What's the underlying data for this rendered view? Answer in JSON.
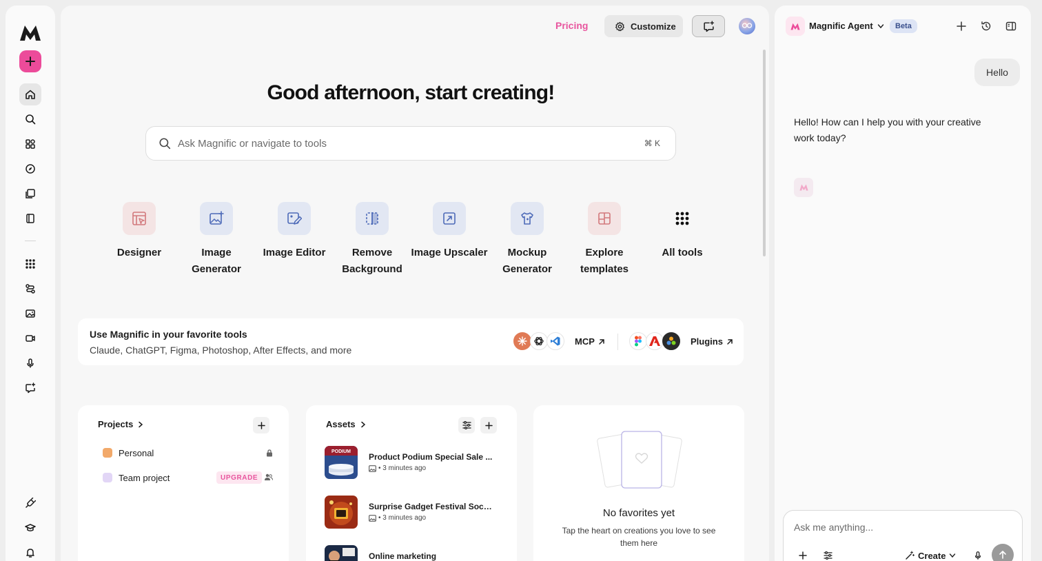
{
  "header": {
    "pricing": "Pricing",
    "customize": "Customize"
  },
  "hero": {
    "greeting": "Good afternoon, start creating!",
    "search_placeholder": "Ask Magnific or navigate to tools",
    "shortcut": "⌘ K"
  },
  "tools": [
    {
      "label": "Designer"
    },
    {
      "label": "Image Generator"
    },
    {
      "label": "Image Editor"
    },
    {
      "label": "Remove Background"
    },
    {
      "label": "Image Upscaler"
    },
    {
      "label": "Mockup Generator"
    },
    {
      "label": "Explore templates"
    },
    {
      "label": "All tools"
    }
  ],
  "integrations": {
    "title": "Use Magnific in your favorite tools",
    "subtitle": "Claude, ChatGPT, Figma, Photoshop, After Effects, and more",
    "mcp": "MCP",
    "plugins": "Plugins"
  },
  "projects": {
    "title": "Projects",
    "items": [
      {
        "name": "Personal",
        "color": "#f2a96a"
      },
      {
        "name": "Team project",
        "color": "#e2d6f6"
      }
    ],
    "upgrade": "UPGRADE"
  },
  "assets": {
    "title": "Assets",
    "items": [
      {
        "name": "Product Podium Special Sale ...",
        "meta": "• 3 minutes ago"
      },
      {
        "name": "Surprise Gadget Festival Soci...",
        "meta": "• 3 minutes ago"
      },
      {
        "name": "Online marketing",
        "meta": ""
      }
    ]
  },
  "favorites": {
    "title": "No favorites yet",
    "subtitle": "Tap the heart on creations you love to see them here"
  },
  "agent": {
    "name": "Magnific Agent",
    "badge": "Beta",
    "user_message": "Hello",
    "reply": "Hello! How can I help you with your creative work today?",
    "input_placeholder": "Ask me anything...",
    "mode": "Create"
  },
  "colors": {
    "accent": "#ec4b9a",
    "pricing": "#e8559e",
    "beta_bg": "#dde4f5"
  }
}
